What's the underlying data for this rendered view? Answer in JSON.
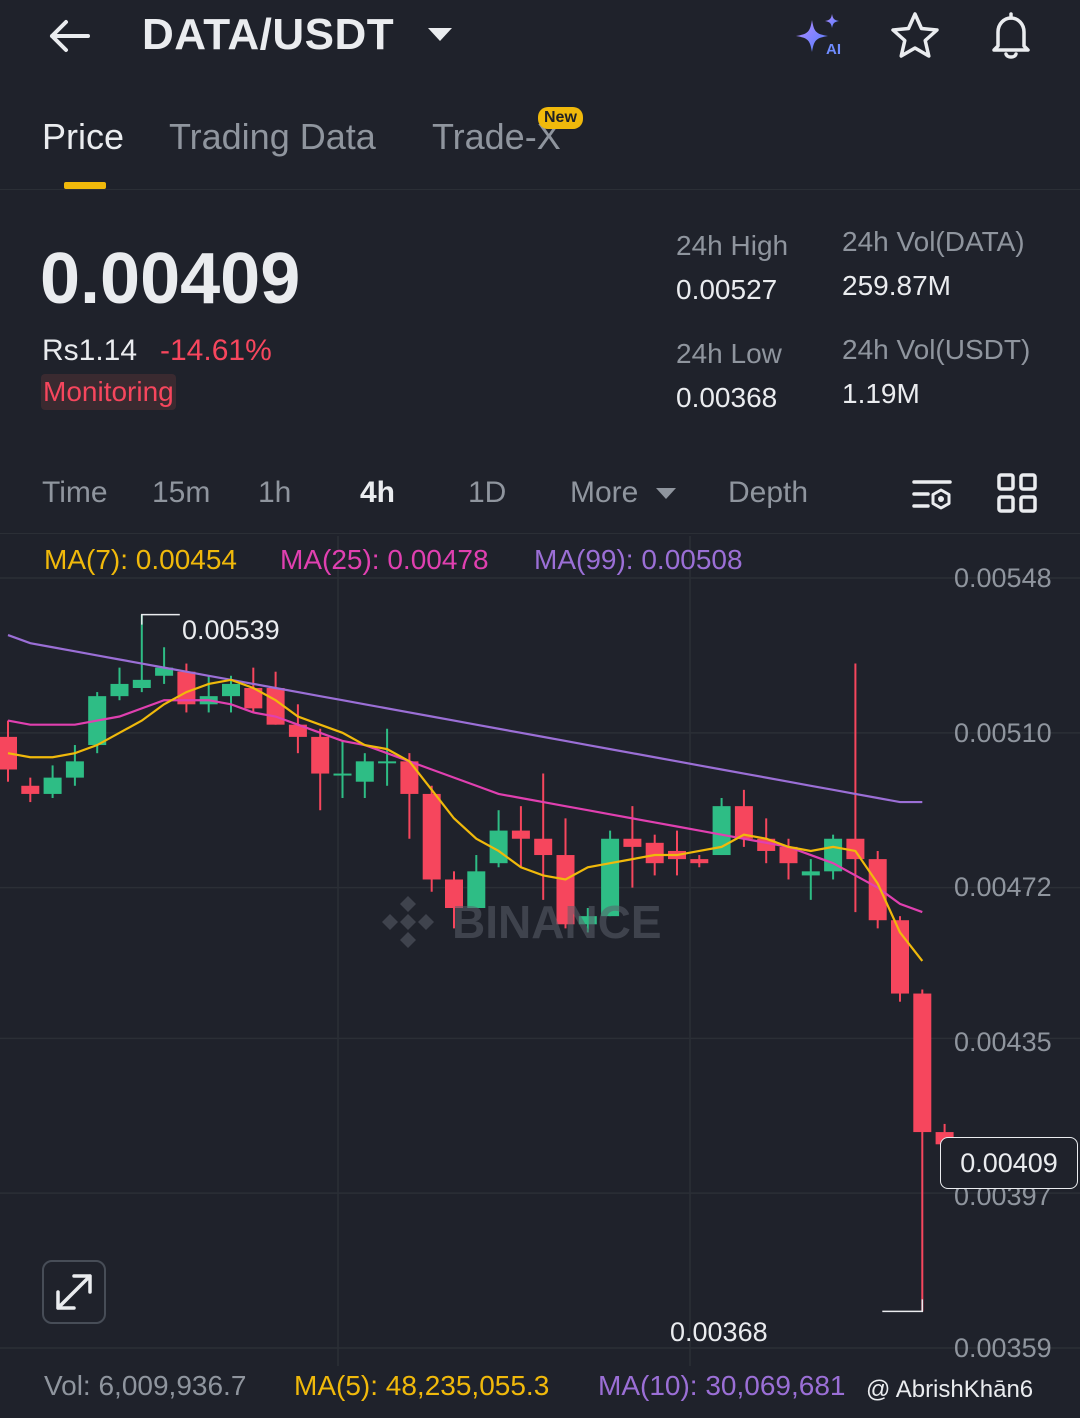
{
  "header": {
    "pair": "DATA/USDT"
  },
  "tabs": {
    "price": "Price",
    "trading_data": "Trading Data",
    "trade_x": "Trade-X",
    "new_badge": "New"
  },
  "ticker": {
    "last_price": "0.00409",
    "fiat": "Rs1.14",
    "change": "-14.61%",
    "tag": "Monitoring",
    "high_label": "24h High",
    "high_value": "0.00527",
    "low_label": "24h Low",
    "low_value": "0.00368",
    "vol_base_label": "24h Vol(DATA)",
    "vol_base_value": "259.87M",
    "vol_quote_label": "24h Vol(USDT)",
    "vol_quote_value": "1.19M"
  },
  "intervals": {
    "time": "Time",
    "m15": "15m",
    "h1": "1h",
    "h4": "4h",
    "d1": "1D",
    "more": "More",
    "depth": "Depth"
  },
  "ma_legend": {
    "ma7": "MA(7): 0.00454",
    "ma25": "MA(25): 0.00478",
    "ma99": "MA(99): 0.00508"
  },
  "colors": {
    "up": "#2ebd85",
    "down": "#f6465d",
    "ma7": "#f0b90b",
    "ma25": "#e040b0",
    "ma99": "#9b6fd6",
    "accent": "#f0b90b"
  },
  "chart_data": {
    "type": "candlestick",
    "interval": "4h",
    "y_ticks": [
      "0.00548",
      "0.00510",
      "0.00472",
      "0.00435",
      "0.00397",
      "0.00359"
    ],
    "ylim": [
      0.00359,
      0.00548
    ],
    "current_price_label": "0.00409",
    "high_marker": "0.00539",
    "low_marker": "0.00368",
    "candles": [
      {
        "o": 0.00509,
        "h": 0.00513,
        "l": 0.00498,
        "c": 0.00501
      },
      {
        "o": 0.00497,
        "h": 0.00499,
        "l": 0.00493,
        "c": 0.00495
      },
      {
        "o": 0.00495,
        "h": 0.00502,
        "l": 0.00494,
        "c": 0.00499
      },
      {
        "o": 0.00499,
        "h": 0.00507,
        "l": 0.00497,
        "c": 0.00503
      },
      {
        "o": 0.00507,
        "h": 0.0052,
        "l": 0.00505,
        "c": 0.00519
      },
      {
        "o": 0.00519,
        "h": 0.00526,
        "l": 0.00518,
        "c": 0.00522
      },
      {
        "o": 0.00521,
        "h": 0.00539,
        "l": 0.0052,
        "c": 0.00523
      },
      {
        "o": 0.00524,
        "h": 0.00531,
        "l": 0.00522,
        "c": 0.00526
      },
      {
        "o": 0.00525,
        "h": 0.00527,
        "l": 0.00515,
        "c": 0.00517
      },
      {
        "o": 0.00517,
        "h": 0.00524,
        "l": 0.00515,
        "c": 0.00519
      },
      {
        "o": 0.00519,
        "h": 0.00524,
        "l": 0.00515,
        "c": 0.00522
      },
      {
        "o": 0.00521,
        "h": 0.00526,
        "l": 0.00515,
        "c": 0.00516
      },
      {
        "o": 0.00521,
        "h": 0.00525,
        "l": 0.00512,
        "c": 0.00512
      },
      {
        "o": 0.00512,
        "h": 0.00517,
        "l": 0.00505,
        "c": 0.00509
      },
      {
        "o": 0.00509,
        "h": 0.00511,
        "l": 0.00491,
        "c": 0.005
      },
      {
        "o": 0.005,
        "h": 0.00508,
        "l": 0.00494,
        "c": 0.005
      },
      {
        "o": 0.00498,
        "h": 0.00505,
        "l": 0.00494,
        "c": 0.00503
      },
      {
        "o": 0.00503,
        "h": 0.00511,
        "l": 0.00497,
        "c": 0.00503
      },
      {
        "o": 0.00503,
        "h": 0.00505,
        "l": 0.00484,
        "c": 0.00495
      },
      {
        "o": 0.00495,
        "h": 0.00497,
        "l": 0.00471,
        "c": 0.00474
      },
      {
        "o": 0.00474,
        "h": 0.00476,
        "l": 0.00462,
        "c": 0.00467
      },
      {
        "o": 0.00467,
        "h": 0.0048,
        "l": 0.00467,
        "c": 0.00476
      },
      {
        "o": 0.00478,
        "h": 0.00491,
        "l": 0.00477,
        "c": 0.00486
      },
      {
        "o": 0.00486,
        "h": 0.00492,
        "l": 0.00477,
        "c": 0.00484
      },
      {
        "o": 0.00484,
        "h": 0.005,
        "l": 0.00469,
        "c": 0.0048
      },
      {
        "o": 0.0048,
        "h": 0.00489,
        "l": 0.00462,
        "c": 0.00463
      },
      {
        "o": 0.00463,
        "h": 0.00467,
        "l": 0.00461,
        "c": 0.00465
      },
      {
        "o": 0.00465,
        "h": 0.00486,
        "l": 0.00465,
        "c": 0.00484
      },
      {
        "o": 0.00484,
        "h": 0.00492,
        "l": 0.00472,
        "c": 0.00482
      },
      {
        "o": 0.00483,
        "h": 0.00485,
        "l": 0.00475,
        "c": 0.00478
      },
      {
        "o": 0.00481,
        "h": 0.00486,
        "l": 0.00475,
        "c": 0.00479
      },
      {
        "o": 0.00479,
        "h": 0.0048,
        "l": 0.00477,
        "c": 0.00478
      },
      {
        "o": 0.0048,
        "h": 0.00494,
        "l": 0.0048,
        "c": 0.00492
      },
      {
        "o": 0.00492,
        "h": 0.00496,
        "l": 0.00482,
        "c": 0.00484
      },
      {
        "o": 0.00484,
        "h": 0.00489,
        "l": 0.00478,
        "c": 0.00481
      },
      {
        "o": 0.00482,
        "h": 0.00484,
        "l": 0.00474,
        "c": 0.00478
      },
      {
        "o": 0.00475,
        "h": 0.00479,
        "l": 0.00469,
        "c": 0.00476
      },
      {
        "o": 0.00476,
        "h": 0.00485,
        "l": 0.00474,
        "c": 0.00484
      },
      {
        "o": 0.00484,
        "h": 0.00527,
        "l": 0.00466,
        "c": 0.00479
      },
      {
        "o": 0.00479,
        "h": 0.00481,
        "l": 0.00462,
        "c": 0.00464
      },
      {
        "o": 0.00464,
        "h": 0.00465,
        "l": 0.00444,
        "c": 0.00446
      },
      {
        "o": 0.00446,
        "h": 0.00447,
        "l": 0.00368,
        "c": 0.00412
      },
      {
        "o": 0.00412,
        "h": 0.00414,
        "l": 0.00409,
        "c": 0.00409
      }
    ],
    "ma7": [
      0.00505,
      0.00504,
      0.00504,
      0.00505,
      0.00507,
      0.0051,
      0.00513,
      0.00517,
      0.0052,
      0.00522,
      0.00523,
      0.00521,
      0.00518,
      0.00514,
      0.00512,
      0.0051,
      0.00507,
      0.00506,
      0.00503,
      0.00496,
      0.00489,
      0.00484,
      0.00481,
      0.00477,
      0.00475,
      0.00474,
      0.00477,
      0.00478,
      0.00479,
      0.0048,
      0.0048,
      0.00481,
      0.00482,
      0.00485,
      0.00484,
      0.00482,
      0.00481,
      0.00482,
      0.00481,
      0.00473,
      0.00461,
      0.00454
    ],
    "ma25": [
      0.00513,
      0.00512,
      0.00512,
      0.00512,
      0.00513,
      0.00514,
      0.00516,
      0.00518,
      0.00518,
      0.00518,
      0.00517,
      0.00515,
      0.00514,
      0.00512,
      0.0051,
      0.00508,
      0.00507,
      0.00505,
      0.00503,
      0.00501,
      0.00499,
      0.00497,
      0.00495,
      0.00494,
      0.00493,
      0.00492,
      0.00491,
      0.0049,
      0.00489,
      0.00488,
      0.00487,
      0.00486,
      0.00485,
      0.00484,
      0.00483,
      0.00482,
      0.0048,
      0.00478,
      0.00475,
      0.00472,
      0.00468,
      0.00466
    ],
    "ma99": [
      0.00534,
      0.00532,
      0.00531,
      0.0053,
      0.00529,
      0.00528,
      0.00527,
      0.00526,
      0.00525,
      0.00524,
      0.00523,
      0.00522,
      0.00521,
      0.0052,
      0.00519,
      0.00518,
      0.00517,
      0.00516,
      0.00515,
      0.00514,
      0.00513,
      0.00512,
      0.00511,
      0.0051,
      0.00509,
      0.00508,
      0.00507,
      0.00506,
      0.00505,
      0.00504,
      0.00503,
      0.00502,
      0.00501,
      0.005,
      0.00499,
      0.00498,
      0.00497,
      0.00496,
      0.00495,
      0.00494,
      0.00493,
      0.00493
    ]
  },
  "volume": {
    "vol": "Vol: 6,009,936.7",
    "ma5": "MA(5): 48,235,055.3",
    "ma10": "MA(10): 30,069,681"
  },
  "watermark": "BINANCE",
  "credit": "@ AbrishKhān6"
}
